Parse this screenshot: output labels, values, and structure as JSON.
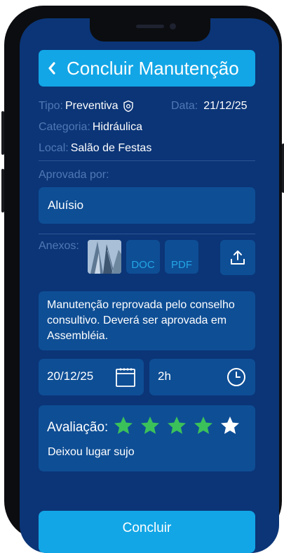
{
  "header": {
    "title": "Concluir Manutenção"
  },
  "info": {
    "tipo_label": "Tipo:",
    "tipo_value": "Preventiva",
    "data_label": "Data:",
    "data_value": "21/12/25",
    "categoria_label": "Categoria:",
    "categoria_value": "Hidráulica",
    "local_label": "Local:",
    "local_value": "Salão de Festas"
  },
  "approval": {
    "label": "Aprovada por:",
    "value": "Aluísio"
  },
  "attachments": {
    "label": "Anexos:",
    "items": [
      {
        "type": "image",
        "label": ""
      },
      {
        "type": "doc",
        "label": "DOC"
      },
      {
        "type": "pdf",
        "label": "PDF"
      }
    ],
    "upload_icon": "upload-icon"
  },
  "note": {
    "text": "Manutenção reprovada pelo conselho consultivo. Deverá ser aprovada em Assembléia."
  },
  "schedule": {
    "date": "20/12/25",
    "duration": "2h"
  },
  "evaluation": {
    "label": "Avaliação:",
    "rating": 4,
    "max": 5,
    "comment": "Deixou lugar sujo"
  },
  "footer": {
    "button_label": "Concluir"
  },
  "colors": {
    "background": "#0b3577",
    "accent": "#12a6e6",
    "field": "#0e4e95",
    "label": "#4f79b4",
    "star_on": "#3bc15a",
    "star_off": "#ffffff"
  }
}
